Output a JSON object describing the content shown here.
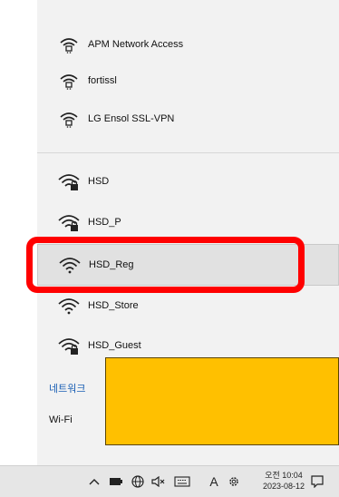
{
  "vpn_connections": [
    {
      "label": "APM Network Access",
      "icon": "vpn-icon"
    },
    {
      "label": "fortissl",
      "icon": "vpn-icon"
    },
    {
      "label": "LG Ensol SSL-VPN",
      "icon": "vpn-icon"
    }
  ],
  "wifi_networks": [
    {
      "label": "HSD",
      "icon": "wifi-secured-icon"
    },
    {
      "label": "HSD_P",
      "icon": "wifi-secured-icon"
    },
    {
      "label": "HSD_Reg",
      "icon": "wifi-icon"
    },
    {
      "label": "HSD_Store",
      "icon": "wifi-icon"
    },
    {
      "label": "HSD_Guest",
      "icon": "wifi-secured-icon"
    }
  ],
  "footer": {
    "network_settings_label": "네트워크",
    "wifi_label": "Wi-Fi"
  },
  "taskbar": {
    "input_mode": "A",
    "time": "오전 10:04",
    "date": "2023-08-12"
  },
  "colors": {
    "highlight": "#ff0000",
    "redaction": "#ffc000",
    "link": "#1a5fb4"
  }
}
